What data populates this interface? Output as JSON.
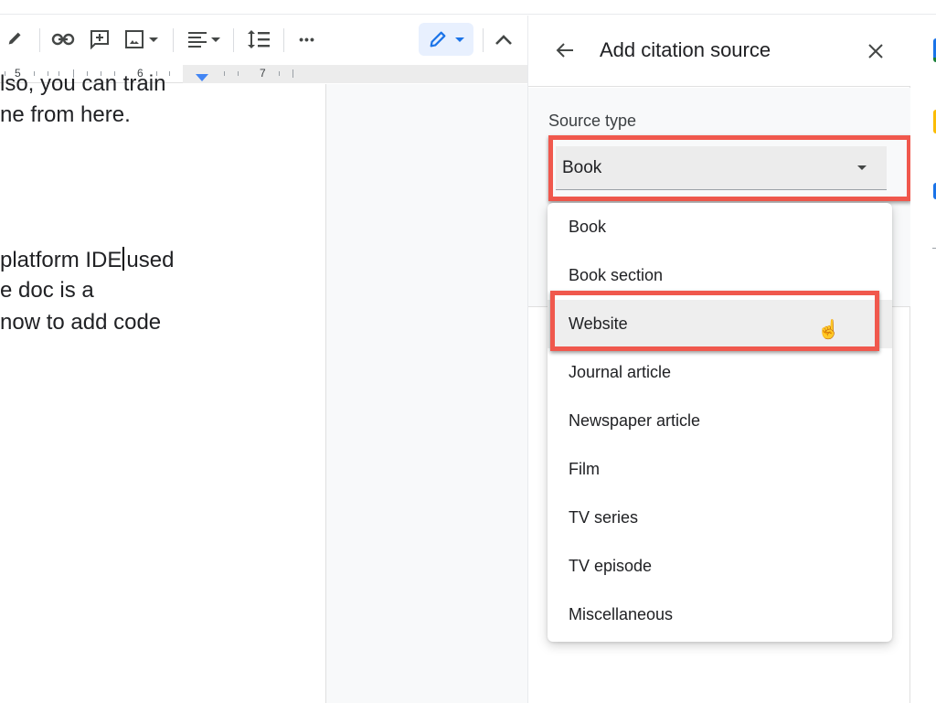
{
  "toolbar": {
    "items": [
      {
        "name": "highlight-pen-icon"
      },
      {
        "name": "insert-link-icon"
      },
      {
        "name": "add-comment-icon"
      },
      {
        "name": "insert-image-icon"
      },
      {
        "name": "align-icon"
      },
      {
        "name": "line-spacing-icon"
      },
      {
        "name": "more-options-icon"
      },
      {
        "name": "editing-mode-icon"
      },
      {
        "name": "collapse-menus-icon"
      }
    ],
    "more_label": "•••"
  },
  "ruler": {
    "labels": [
      "5",
      "6",
      "7"
    ]
  },
  "document": {
    "lines": [
      "lso, you can train",
      "ne from here.",
      "platform IDE",
      "used",
      "e doc is a",
      "now to add code"
    ]
  },
  "citation_panel": {
    "title": "Add citation source",
    "back_label": "←",
    "close_label": "✕",
    "source_type_label": "Source type",
    "source_type_value": "Book",
    "options": [
      "Book",
      "Book section",
      "Website",
      "Journal article",
      "Newspaper article",
      "Film",
      "TV series",
      "TV episode",
      "Miscellaneous"
    ],
    "hovered_option": "Website"
  },
  "colors": {
    "accent": "#1a73e8",
    "highlight_box": "#f0584d",
    "text": "#202124"
  }
}
